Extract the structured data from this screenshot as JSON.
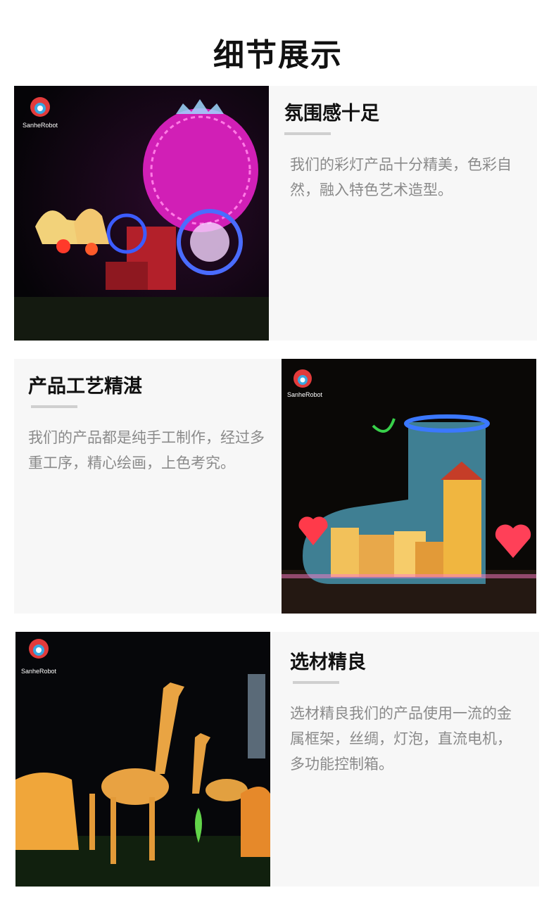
{
  "page_title": "细节展示",
  "logo_text": "SanheRobot",
  "sections": [
    {
      "title": "氛围感十足",
      "description": "我们的彩灯产品十分精美，色彩自然，融入特色艺术造型。",
      "photo_subject": "pumpkin-carriage-lantern"
    },
    {
      "title": "产品工艺精湛",
      "description": "我们的产品都是纯手工制作，经过多重工序，精心绘画，上色考究。",
      "photo_subject": "boot-house-lantern"
    },
    {
      "title": "选材精良",
      "description": "选材精良我们的产品使用一流的金属框架，丝绸，灯泡，直流电机，多功能控制箱。",
      "photo_subject": "giraffe-lanterns"
    }
  ],
  "colors": {
    "card_background": "#f7f7f7",
    "heading": "#111111",
    "description": "#8a8a8a",
    "rule": "#cfcfcf"
  }
}
